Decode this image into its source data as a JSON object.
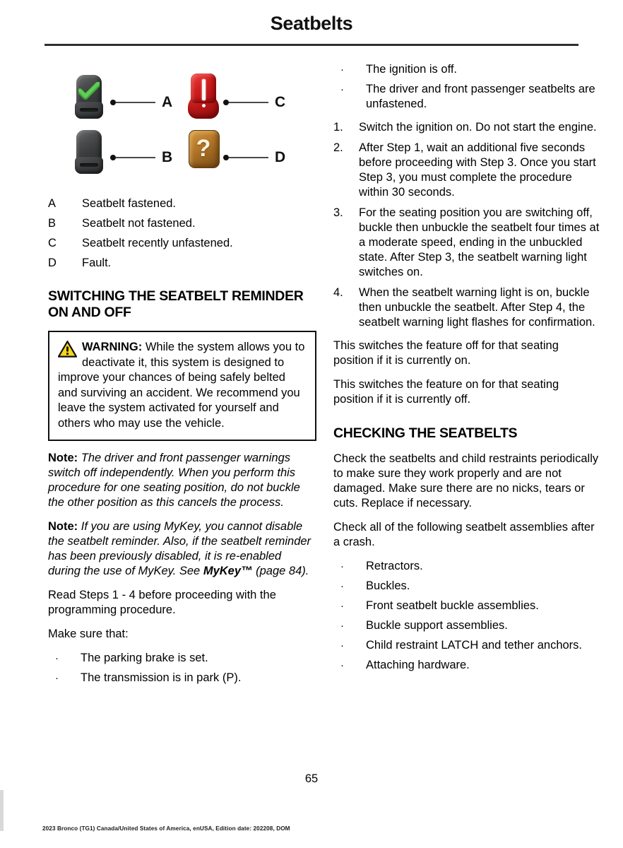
{
  "document": {
    "title": "Seatbelts",
    "page_number": "65",
    "footer": "2023 Bronco (TG1) Canada/United States of America, enUSA, Edition date: 202208, DOM"
  },
  "figure": {
    "items": [
      {
        "key": "A",
        "icon": "buckle-fastened-icon"
      },
      {
        "key": "B",
        "icon": "buckle-unfastened-icon"
      },
      {
        "key": "C",
        "icon": "red-warning-lamp-icon"
      },
      {
        "key": "D",
        "icon": "amber-question-fault-icon"
      }
    ],
    "question_mark": "?"
  },
  "legend": [
    {
      "key": "A",
      "text": "Seatbelt fastened."
    },
    {
      "key": "B",
      "text": "Seatbelt not fastened."
    },
    {
      "key": "C",
      "text": "Seatbelt recently unfastened."
    },
    {
      "key": "D",
      "text": "Fault."
    }
  ],
  "left_column": {
    "section_heading": "SWITCHING THE SEATBELT REMINDER ON AND OFF",
    "warning": {
      "label": "WARNING:",
      "text": " While the system allows you to deactivate it, this system is designed to improve your chances of being safely belted and surviving an accident. We recommend you leave the system activated for yourself and others who may use the vehicle."
    },
    "note_1": {
      "label": "Note:",
      "text": " The driver and front passenger warnings switch off independently. When you perform this procedure for one seating position, do not buckle the other position as this cancels the process."
    },
    "note_2": {
      "label": "Note:",
      "text_before": " If you are using MyKey, you cannot disable the seatbelt reminder. Also, if the seatbelt reminder has been previously disabled, it is re-enabled during the use of MyKey.  See ",
      "link_text": "MyKey™",
      "text_after": " (page 84)."
    },
    "paragraph_1": "Read Steps 1 - 4 before proceeding with the programming procedure.",
    "paragraph_2": "Make sure that:",
    "bullets": [
      "The parking brake is set.",
      "The transmission is in park (P)."
    ]
  },
  "right_column": {
    "bullets_top": [
      "The ignition is off.",
      "The driver and front passenger seatbelts are unfastened."
    ],
    "steps": [
      {
        "number": "1.",
        "text": "Switch the ignition on.  Do not start the engine."
      },
      {
        "number": "2.",
        "text": "After Step 1, wait an additional five seconds before proceeding with Step 3. Once you start Step 3, you must complete the procedure within 30 seconds."
      },
      {
        "number": "3.",
        "text": "For the seating position you are switching off, buckle then unbuckle the seatbelt four times at a moderate speed, ending in the unbuckled state. After Step 3, the seatbelt warning light switches on."
      },
      {
        "number": "4.",
        "text": "When the seatbelt warning light is on, buckle then unbuckle the seatbelt. After Step 4, the seatbelt warning light flashes for confirmation."
      }
    ],
    "result_1": "This switches the feature off for that seating position if it is currently on.",
    "result_2": "This switches the feature on for that seating position if it is currently off.",
    "section_heading": "CHECKING THE SEATBELTS",
    "paragraph_1": "Check the seatbelts and child restraints periodically to make sure they work properly and are not damaged. Make sure there are no nicks, tears or cuts. Replace if necessary.",
    "paragraph_2": "Check all of the following seatbelt assemblies after a crash.",
    "bullets": [
      "Retractors.",
      "Buckles.",
      "Front seatbelt buckle assemblies.",
      "Buckle support assemblies.",
      "Child restraint LATCH and tether anchors.",
      "Attaching hardware."
    ]
  },
  "bullet_glyph": "·",
  "colors": {
    "rule": "#2f3033",
    "warning_yellow": "#f5d718",
    "lamp_red": "#d41f1f",
    "fault_amber": "#b8782a",
    "check_green": "#4cb849"
  }
}
